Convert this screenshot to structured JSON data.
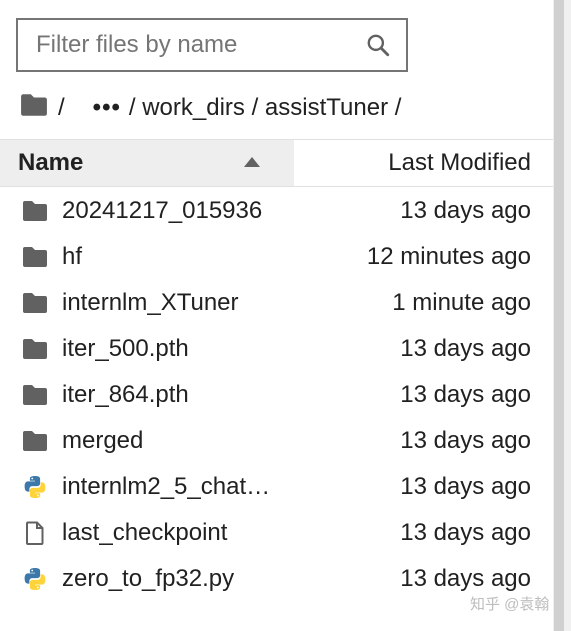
{
  "search": {
    "placeholder": "Filter files by name",
    "value": ""
  },
  "breadcrumb": {
    "root_sep": "/",
    "ellipsis": "•••",
    "path": "/ work_dirs / assistTuner /"
  },
  "header": {
    "name": "Name",
    "last_modified": "Last Modified",
    "sort": "ascending"
  },
  "files": [
    {
      "name": "20241217_015936",
      "modified": "13 days ago",
      "icon": "folder-icon"
    },
    {
      "name": "hf",
      "modified": "12 minutes ago",
      "icon": "folder-icon"
    },
    {
      "name": "internlm_XTuner",
      "modified": "1 minute ago",
      "icon": "folder-icon"
    },
    {
      "name": "iter_500.pth",
      "modified": "13 days ago",
      "icon": "folder-icon"
    },
    {
      "name": "iter_864.pth",
      "modified": "13 days ago",
      "icon": "folder-icon"
    },
    {
      "name": "merged",
      "modified": "13 days ago",
      "icon": "folder-icon"
    },
    {
      "name": "internlm2_5_chat…",
      "modified": "13 days ago",
      "icon": "python-icon"
    },
    {
      "name": "last_checkpoint",
      "modified": "13 days ago",
      "icon": "file-icon"
    },
    {
      "name": "zero_to_fp32.py",
      "modified": "13 days ago",
      "icon": "python-icon"
    }
  ],
  "watermark": "知乎 @袁翰",
  "colors": {
    "folder": "#616161",
    "python_blue": "#3c78aa",
    "python_yellow": "#ffd43b"
  }
}
